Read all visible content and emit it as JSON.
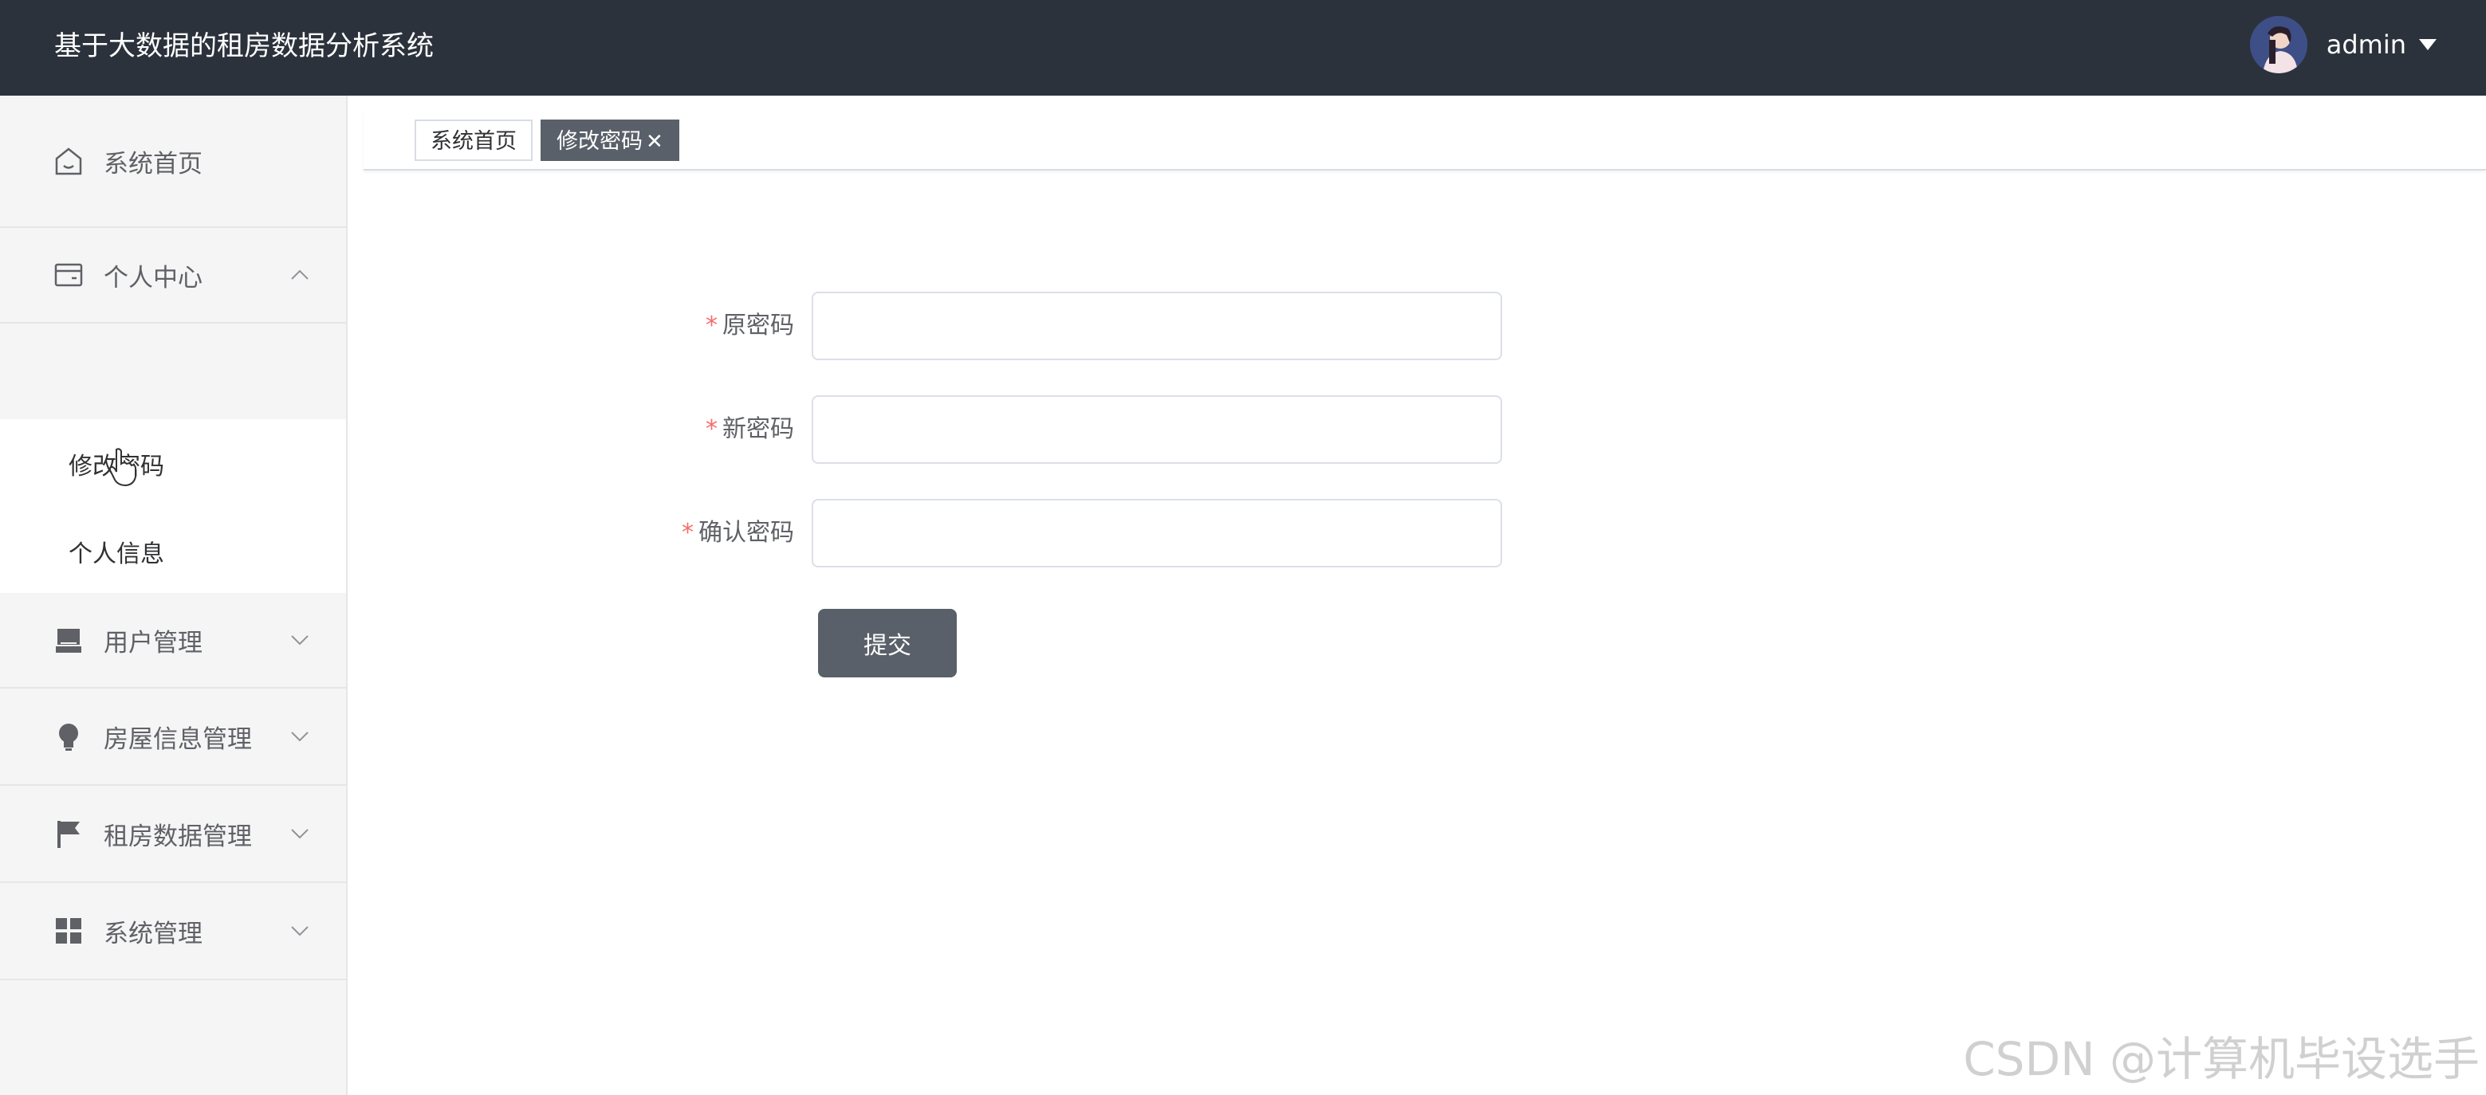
{
  "header": {
    "title": "基于大数据的租房数据分析系统",
    "username": "admin",
    "avatar_icon": "avatar-icon",
    "dropdown_icon": "caret-down-icon"
  },
  "sidebar": {
    "items": [
      {
        "label": "系统首页",
        "icon": "home-icon",
        "expanded": false
      },
      {
        "label": "个人中心",
        "icon": "wallet-icon",
        "expanded": true,
        "children": [
          {
            "label": "修改密码"
          },
          {
            "label": "个人信息"
          }
        ]
      },
      {
        "label": "用户管理",
        "icon": "inbox-icon",
        "expanded": false
      },
      {
        "label": "房屋信息管理",
        "icon": "bulb-icon",
        "expanded": false
      },
      {
        "label": "租房数据管理",
        "icon": "flag-icon",
        "expanded": false
      },
      {
        "label": "系统管理",
        "icon": "grid-icon",
        "expanded": false
      }
    ]
  },
  "tags": {
    "home": "系统首页",
    "active": "修改密码",
    "close_glyph": "✕"
  },
  "form": {
    "old_password": {
      "label": "原密码",
      "value": "",
      "required": true
    },
    "new_password": {
      "label": "新密码",
      "value": "",
      "required": true
    },
    "confirm_password": {
      "label": "确认密码",
      "value": "",
      "required": true
    },
    "required_mark": "*",
    "submit_label": "提交"
  },
  "watermark": "CSDN @计算机毕设选手",
  "colors": {
    "header_bg": "#2b323c",
    "sidebar_bg": "#f5f5f5",
    "accent": "#5a6069",
    "required": "#f56c6c"
  }
}
